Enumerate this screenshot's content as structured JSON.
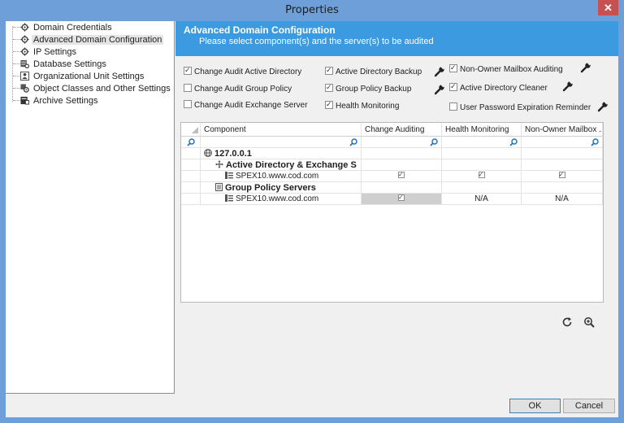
{
  "window": {
    "title": "Properties",
    "close_glyph": "✕"
  },
  "tree": {
    "items": [
      {
        "label": "Domain Credentials",
        "icon": "gear-icon"
      },
      {
        "label": "Advanced Domain Configuration",
        "icon": "gear-icon",
        "selected": true
      },
      {
        "label": "IP Settings",
        "icon": "gear-icon"
      },
      {
        "label": "Database Settings",
        "icon": "database-gear-icon"
      },
      {
        "label": "Organizational Unit Settings",
        "icon": "ou-icon"
      },
      {
        "label": "Object Classes and Other Settings",
        "icon": "gear-icon"
      },
      {
        "label": "Archive Settings",
        "icon": "archive-icon"
      }
    ]
  },
  "header": {
    "title": "Advanced Domain Configuration",
    "subtitle": "Please select component(s) and the server(s) to be audited"
  },
  "options": [
    {
      "label": "Change Audit Active Directory",
      "checked": true
    },
    {
      "label": "Change Audit Group Policy",
      "checked": false
    },
    {
      "label": "Change Audit Exchange Server",
      "checked": false
    },
    {
      "label": "Active Directory Backup",
      "checked": true,
      "wrench": true
    },
    {
      "label": "Group Policy Backup",
      "checked": true,
      "wrench": true
    },
    {
      "label": "Health Monitoring",
      "checked": true
    },
    {
      "label": "Non-Owner Mailbox Auditing",
      "checked": true,
      "wrench": true
    },
    {
      "label": "Active Directory Cleaner",
      "checked": true,
      "wrench": true
    },
    {
      "label": "User Password Expiration Reminder",
      "checked": false,
      "wrench": true
    }
  ],
  "grid": {
    "columns": [
      "Component",
      "Change Auditing",
      "Health Monitoring",
      "Non-Owner Mailbox ..."
    ],
    "rows": [
      {
        "component": "127.0.0.1",
        "level": 0,
        "icon": "globe-icon",
        "bold": true
      },
      {
        "component": "Active Directory & Exchange S",
        "level": 1,
        "icon": "ad-icon",
        "bold": true
      },
      {
        "component": "SPEX10.www.cod.com",
        "level": 2,
        "icon": "server-icon",
        "change": "check",
        "health": "check",
        "nonowner": "check"
      },
      {
        "component": "Group Policy Servers",
        "level": 1,
        "icon": "gpo-icon",
        "bold": true
      },
      {
        "component": "SPEX10.www.cod.com",
        "level": 2,
        "icon": "server-icon",
        "change": "check-disabled",
        "health": "N/A",
        "nonowner": "N/A"
      }
    ]
  },
  "toolbar": {
    "refresh_icon": "refresh-icon",
    "zoom_icon": "zoom-icon"
  },
  "footer": {
    "ok_label": "OK",
    "cancel_label": "Cancel"
  }
}
